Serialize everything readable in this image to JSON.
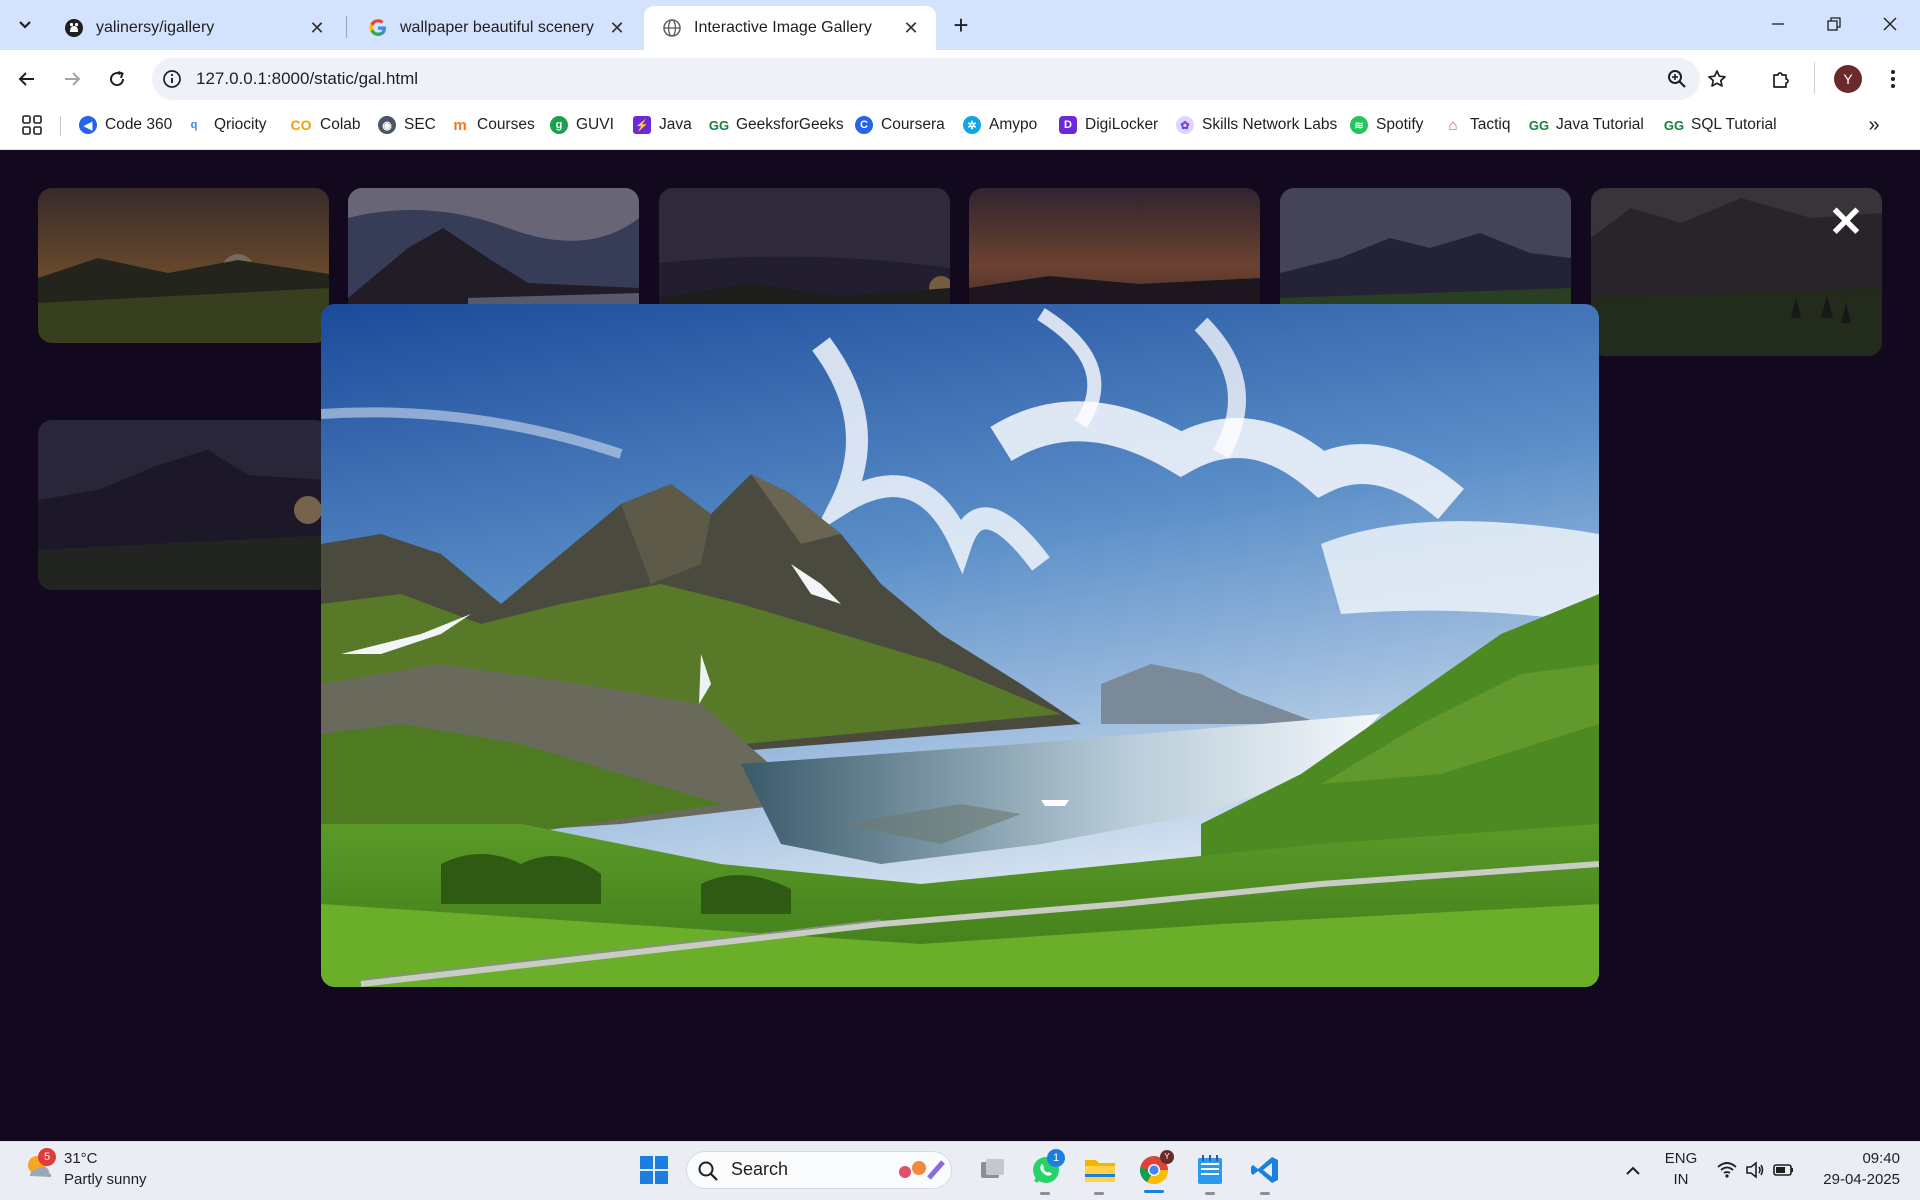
{
  "browser": {
    "tabs": [
      {
        "title": "yalinersy/igallery",
        "icon": "github-icon",
        "active": false
      },
      {
        "title": "wallpaper beautiful scenery mo",
        "icon": "google-icon",
        "active": false
      },
      {
        "title": "Interactive Image Gallery",
        "icon": "globe-icon",
        "active": true
      }
    ],
    "new_tab": "+",
    "url": "127.0.0.1:8000/static/gal.html",
    "profile_initial": "Y",
    "bookmarks": [
      {
        "label": "Code 360",
        "color": "#2563eb"
      },
      {
        "label": "Qriocity",
        "color": "#3b82f6"
      },
      {
        "label": "Colab",
        "color": "#f59e0b"
      },
      {
        "label": "SEC",
        "color": "#4b5563"
      },
      {
        "label": "Courses",
        "color": "#f97316"
      },
      {
        "label": "GUVI",
        "color": "#16a34a"
      },
      {
        "label": "Java",
        "color": "#6d28d9"
      },
      {
        "label": "GeeksforGeeks",
        "color": "#15803d"
      },
      {
        "label": "Coursera",
        "color": "#2563eb"
      },
      {
        "label": "Amypo",
        "color": "#0ea5e9"
      },
      {
        "label": "DigiLocker",
        "color": "#6d28d9"
      },
      {
        "label": "Skills Network Labs",
        "color": "#a78bfa"
      },
      {
        "label": "Spotify",
        "color": "#22c55e"
      },
      {
        "label": "Tactiq",
        "color": "#ec4899"
      },
      {
        "label": "Java Tutorial",
        "color": "#15803d"
      },
      {
        "label": "SQL Tutorial",
        "color": "#15803d"
      }
    ]
  },
  "gallery": {
    "close_label": "✕",
    "thumbnails": [
      {
        "scene": "sunset-hills"
      },
      {
        "scene": "mountain-lake"
      },
      {
        "scene": "dark-sunset-valley"
      },
      {
        "scene": "orange-cloud-sky"
      },
      {
        "scene": "green-mountain-valley"
      },
      {
        "scene": "forest-valley"
      },
      {
        "scene": "mountain-sunburst"
      }
    ],
    "modal_image": "norway-fjord-mountains"
  },
  "taskbar": {
    "weather_temp": "31°C",
    "weather_desc": "Partly sunny",
    "weather_badge": "5",
    "search_label": "Search",
    "whatsapp_badge": "1",
    "lang_top": "ENG",
    "lang_bottom": "IN",
    "time": "09:40",
    "date": "29-04-2025"
  },
  "colors": {
    "page_bg": "#12091f",
    "tabstrip_bg": "#d3e3fd"
  }
}
